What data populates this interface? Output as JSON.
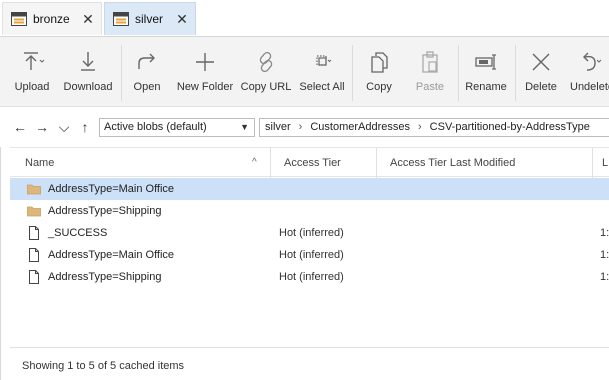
{
  "tabs": [
    {
      "label": "bronze",
      "close": "✕"
    },
    {
      "label": "silver",
      "close": "✕"
    }
  ],
  "toolbar": {
    "upload": "Upload",
    "download": "Download",
    "open": "Open",
    "new_folder": "New Folder",
    "copy_url": "Copy URL",
    "select_all": "Select All",
    "copy": "Copy",
    "paste": "Paste",
    "rename": "Rename",
    "delete": "Delete",
    "undelete": "Undelete"
  },
  "nav": {
    "back": "←",
    "forward": "→",
    "dropdown": "⌵",
    "up": "↑"
  },
  "blob_select": {
    "value": "Active blobs (default)",
    "caret": "▼"
  },
  "breadcrumb": [
    "silver",
    "CustomerAddresses",
    "CSV-partitioned-by-AddressType"
  ],
  "breadcrumb_sep": "›",
  "columns": {
    "name": "Name",
    "sort_indicator": "^",
    "access_tier": "Access Tier",
    "last_modified": "Access Tier Last Modified",
    "next": "L"
  },
  "rows": [
    {
      "icon": "folder-icon",
      "name": "AddressType=Main Office",
      "tier": "",
      "lm": "",
      "selected": true
    },
    {
      "icon": "folder-icon",
      "name": "AddressType=Shipping",
      "tier": "",
      "lm": "",
      "selected": false
    },
    {
      "icon": "file-icon",
      "name": "_SUCCESS",
      "tier": "Hot (inferred)",
      "lm": "1:",
      "selected": false
    },
    {
      "icon": "file-icon",
      "name": "AddressType=Main Office",
      "tier": "Hot (inferred)",
      "lm": "1:",
      "selected": false
    },
    {
      "icon": "file-icon",
      "name": "AddressType=Shipping",
      "tier": "Hot (inferred)",
      "lm": "1:",
      "selected": false
    }
  ],
  "status": "Showing 1 to 5 of 5 cached items",
  "colors": {
    "selected_row": "#cce0f7",
    "active_tab": "#dbe8f6",
    "folder": "#dcb67a",
    "toolbar_icon": "#555555"
  }
}
